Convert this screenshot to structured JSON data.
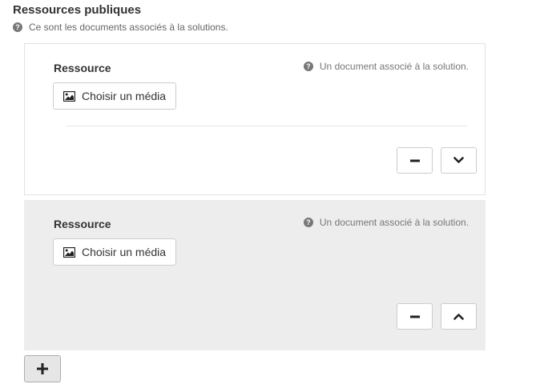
{
  "section": {
    "title": "Ressources publiques",
    "help": "Ce sont les documents associés à la solutions."
  },
  "items": [
    {
      "label": "Ressource",
      "help": "Un document associé à la solution.",
      "media_button": "Choisir un média",
      "move_icon": "chevron-down-icon"
    },
    {
      "label": "Ressource",
      "help": "Un document associé à la solution.",
      "media_button": "Choisir un média",
      "move_icon": "chevron-up-icon"
    }
  ],
  "icons": {
    "help": "question-circle-icon",
    "media": "image-icon",
    "remove": "minus-icon",
    "add": "plus-icon"
  },
  "colors": {
    "item_active_bg": "#ffffff",
    "item_inactive_bg": "#ededed",
    "add_button_bg": "#e6e6e6"
  }
}
